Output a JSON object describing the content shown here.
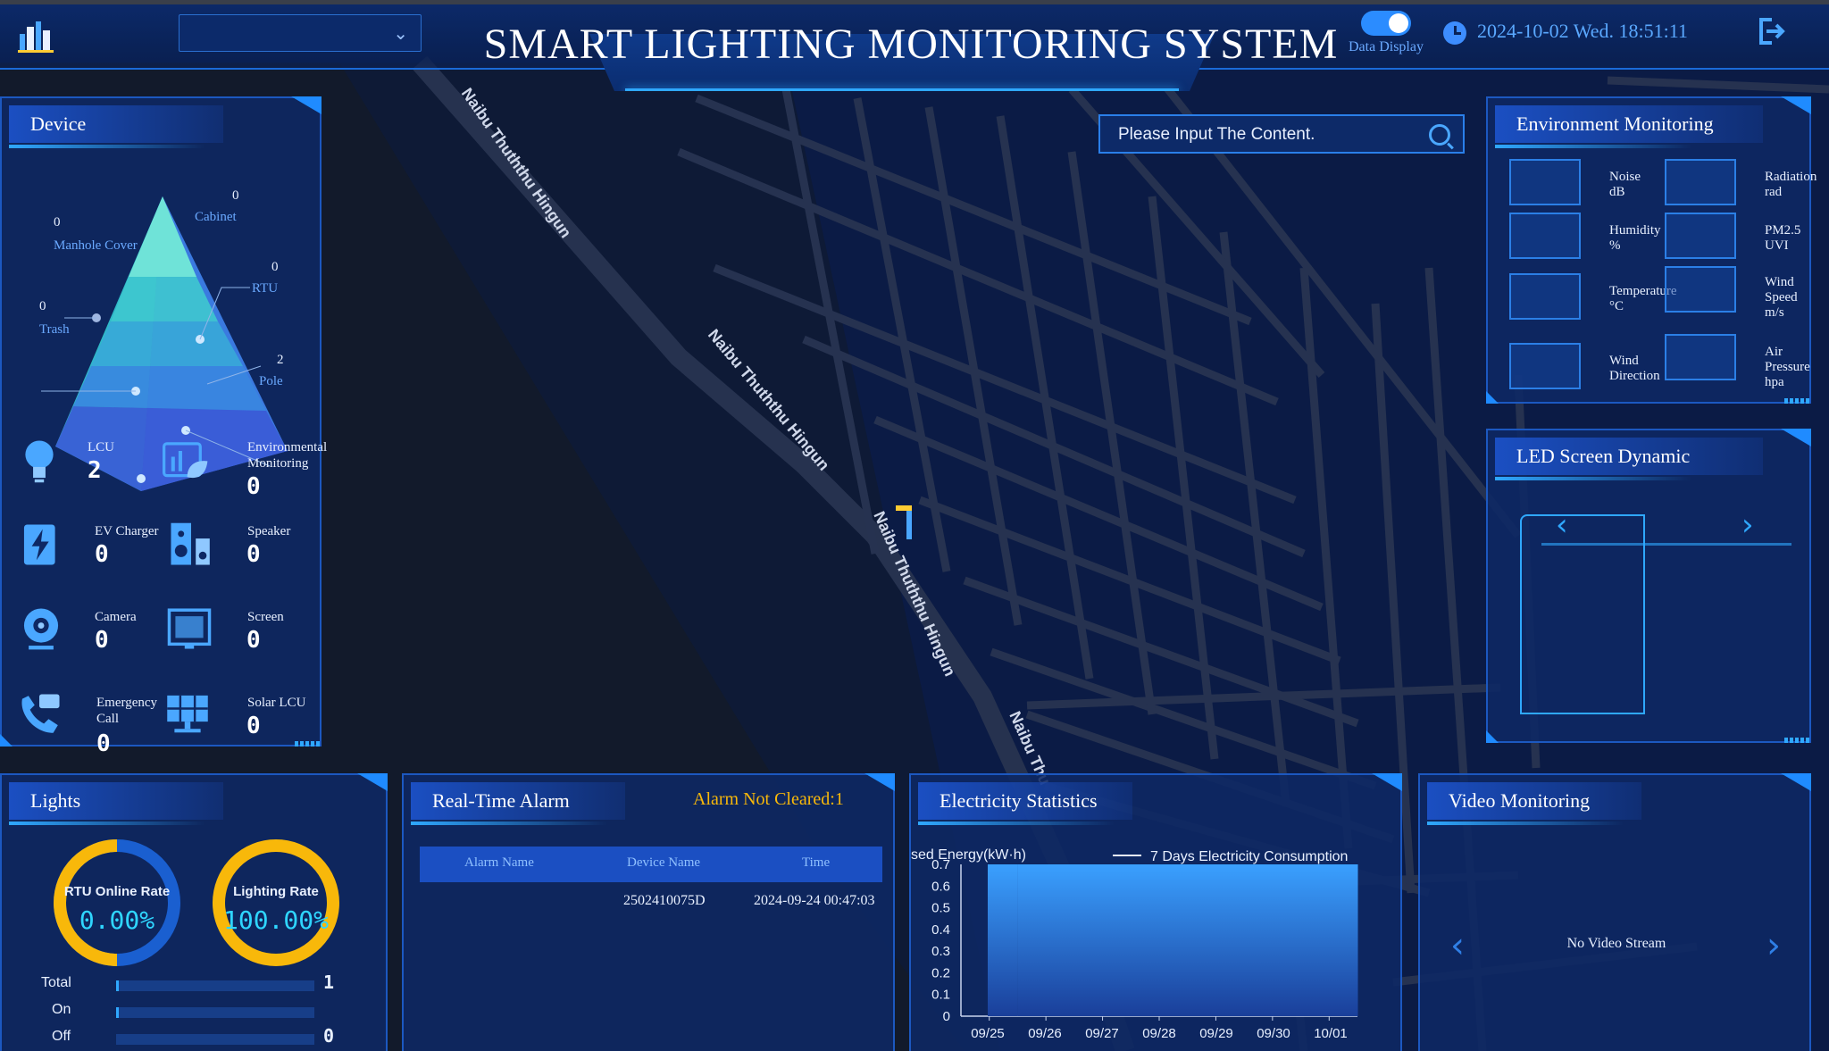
{
  "header": {
    "title": "SMART LIGHTING MONITORING SYSTEM",
    "dropdown_value": "",
    "toggle_label": "Data Display",
    "datetime": "2024-10-02 Wed. 18:51:11"
  },
  "map": {
    "street_labels": [
      "Naibu Thuththu Hingun",
      "Naibu Thuththu Hingun",
      "Naibu Thuththu Hingun",
      "Naibu Thu"
    ],
    "search_placeholder": "Please Input The Content."
  },
  "device": {
    "title": "Device",
    "pyramid": [
      {
        "label": "Cabinet",
        "value": "0"
      },
      {
        "label": "Manhole Cover",
        "value": "0"
      },
      {
        "label": "RTU",
        "value": "0"
      },
      {
        "label": "Trash",
        "value": "0"
      },
      {
        "label": "Pole",
        "value": "2"
      }
    ],
    "items": [
      {
        "label": "LCU",
        "value": "2"
      },
      {
        "label": "Environmental Monitoring",
        "value": "0"
      },
      {
        "label": "EV Charger",
        "value": "0"
      },
      {
        "label": "Speaker",
        "value": "0"
      },
      {
        "label": "Camera",
        "value": "0"
      },
      {
        "label": "Screen",
        "value": "0"
      },
      {
        "label": "Emergency Call",
        "value": "0"
      },
      {
        "label": "Solar LCU",
        "value": "0"
      }
    ]
  },
  "environment": {
    "title": "Environment Monitoring",
    "items": [
      {
        "label": "Noise",
        "unit": "dB",
        "icon": "noise-icon"
      },
      {
        "label": "Radiation",
        "unit": "rad",
        "icon": "radiation-icon"
      },
      {
        "label": "Humidity",
        "unit": "%",
        "icon": "humidity-icon"
      },
      {
        "label": "PM2.5",
        "unit": "UVI",
        "icon": "pm25-icon"
      },
      {
        "label": "Temperature",
        "unit": "°C",
        "icon": "thermometer-icon"
      },
      {
        "label": "Wind Speed",
        "unit": "m/s",
        "icon": "wind-speed-icon"
      },
      {
        "label": "Wind Direction",
        "unit": "",
        "icon": "wind-direction-icon"
      },
      {
        "label": "Air Pressure",
        "unit": "hpa",
        "icon": "gauge-icon"
      }
    ]
  },
  "led": {
    "title": "LED Screen Dynamic"
  },
  "lights": {
    "title": "Lights",
    "rings": [
      {
        "label": "RTU Online Rate",
        "value": "0.00%",
        "fraction": 0.0
      },
      {
        "label": "Lighting Rate",
        "value": "100.00%",
        "fraction": 1.0
      }
    ],
    "rows": [
      {
        "label": "Total",
        "value": "1",
        "fraction": 0.01
      },
      {
        "label": "On",
        "value": "",
        "fraction": 0.01
      },
      {
        "label": "Off",
        "value": "0",
        "fraction": 0.0
      }
    ]
  },
  "alarm": {
    "title": "Real-Time Alarm",
    "status": "Alarm Not Cleared:",
    "status_count": "1",
    "columns": [
      "Alarm Name",
      "Device Name",
      "Time"
    ],
    "rows": [
      {
        "alarm": "",
        "device": "2502410075D",
        "time": "2024-09-24 00:47:03"
      }
    ]
  },
  "electricity": {
    "title": "Electricity Statistics",
    "ylabel": "sed Energy(kW·h)",
    "legend": "7 Days Electricity Consumption"
  },
  "video": {
    "title": "Video Monitoring",
    "message": "No Video Stream"
  },
  "chart_data": {
    "type": "bar",
    "title": "",
    "legend": "7 Days Electricity Consumption",
    "ylabel": "sed Energy(kW·h)",
    "xlabel": "",
    "categories": [
      "09/25",
      "09/26",
      "09/27",
      "09/28",
      "09/29",
      "09/30",
      "10/01"
    ],
    "series": [
      {
        "name": "7 Days Electricity Consumption",
        "values": [
          0.7,
          0.7,
          0.7,
          0.7,
          0.7,
          0.7,
          0.7
        ]
      }
    ],
    "yticks": [
      "0",
      "0.1",
      "0.2",
      "0.3",
      "0.4",
      "0.5",
      "0.6",
      "0.7"
    ],
    "ylim": [
      0,
      0.7
    ],
    "colors": {
      "bar_top": "#3aa0ff",
      "bar_bottom": "#1a3f9a"
    }
  }
}
